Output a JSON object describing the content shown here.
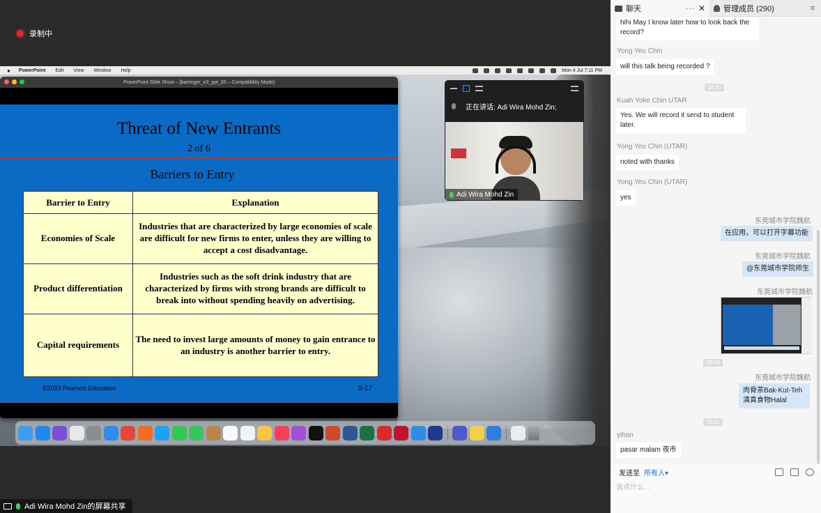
{
  "recording": {
    "label": "录制中"
  },
  "menubar": {
    "apple": "",
    "items": [
      "PowerPoint",
      "Edit",
      "View",
      "Window",
      "Help"
    ],
    "clock": "Mon 4 Jul  7:11 PM"
  },
  "ppt_window": {
    "title": "PowerPoint Slide Show – [barringer_e3_ppt_05 – Compatibility Mode]"
  },
  "slide": {
    "title": "Threat of New Entrants",
    "subtitle": "2 of 6",
    "heading": "Barriers to Entry",
    "table": {
      "headers": [
        "Barrier to Entry",
        "Explanation"
      ],
      "rows": [
        [
          "Economies of Scale",
          "Industries that are characterized by large economies of scale are difficult for new firms to enter, unless they are willing to accept a cost disadvantage."
        ],
        [
          "Product differentiation",
          "Industries such as the soft drink industry that are characterized by firms with strong brands are difficult to break into without spending heavily on advertising."
        ],
        [
          "Capital requirements",
          "The need to invest large amounts of money to gain entrance to an industry is another barrier to entry."
        ]
      ]
    },
    "footer_left": "©2010 Pearson Education",
    "footer_right": "5-17"
  },
  "video": {
    "speaking": "正在讲话: Adi Wira Mohd Zin;",
    "name": "Adi Wira Mohd Zin"
  },
  "share_bar": {
    "label": "Adi Wira Mohd Zin的屏幕共享"
  },
  "chat": {
    "tab_chat": "聊天",
    "tab_more": "···",
    "tab_close": "✕",
    "tab_members": "管理成员 (290)",
    "tab_menu": "≡",
    "messages": [
      {
        "text": "hihi May I know later how to look back the record?"
      },
      {
        "sender": "Yong Yeu Chin",
        "text": "will this talk being recorded ?"
      },
      {
        "stamp": "18:41"
      },
      {
        "sender": "Kuah Yoke Chin UTAR",
        "text": "Yes. We will record it send to student later."
      },
      {
        "sender": "Yong Yeu Chin (UTAR)",
        "text": "noted with thanks"
      },
      {
        "sender": "Yong Yeu Chin (UTAR)",
        "text": "yes"
      },
      {
        "sender": "东莞城市学院魏航",
        "text": "在应用，可以打开字幕功能"
      },
      {
        "sender": "东莞城市学院魏航",
        "text": "@东莞城市学院师生"
      },
      {
        "sender": "东莞城市学院魏航"
      },
      {
        "stamp": "18:54"
      },
      {
        "sender": "东莞城市学院魏航",
        "text": "肉骨茶Bak-Kut-Teh 清真食物Halal"
      },
      {
        "stamp": "19:01"
      },
      {
        "sender": "yihan",
        "text": "pasar malam 夜市"
      }
    ],
    "send_to_label": "发送至",
    "send_to_target": "所有人▾",
    "input_placeholder": "说点什么..."
  }
}
